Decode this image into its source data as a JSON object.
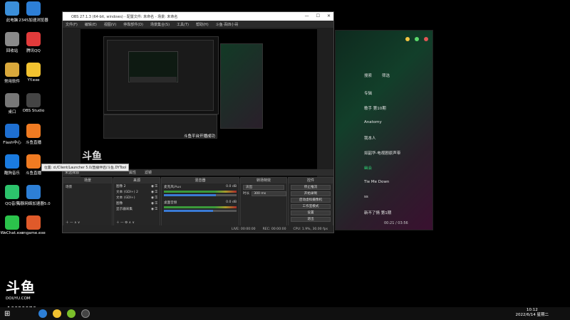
{
  "desktop_icons": [
    {
      "label": "此电脑",
      "color": "#3b8fd9"
    },
    {
      "label": "2345加速浏览器",
      "color": "#2d7fd6"
    },
    {
      "label": "回收站",
      "color": "#8a8a8a"
    },
    {
      "label": "腾讯QQ",
      "color": "#e23b3b"
    },
    {
      "label": "常用软件",
      "color": "#d9a83b"
    },
    {
      "label": "YY.exe",
      "color": "#f2c230"
    },
    {
      "label": "桌口",
      "color": "#777"
    },
    {
      "label": "OBS Studio",
      "color": "#444"
    },
    {
      "label": "Flash中心",
      "color": "#1e6fd1"
    },
    {
      "label": "斗鱼直播",
      "color": "#f07b22"
    },
    {
      "label": "酷狗音乐",
      "color": "#1a7be0"
    },
    {
      "label": "斗鱼直播",
      "color": "#f07b22"
    },
    {
      "label": "QQ音乐",
      "color": "#2cc36b"
    },
    {
      "label": "海豚网络加速器5.0",
      "color": "#2d7fd6"
    },
    {
      "label": "WeChat.exe",
      "color": "#2bc34b"
    },
    {
      "label": "cngame.exe",
      "color": "#e05a2a"
    }
  ],
  "tooltip": "位置: d:/Client/Launcher 5.0/直播伴侣/斗鱼.DYTool",
  "obs": {
    "title": "OBS 27.1.3 (64-bit, windows) - 配置文件: 未命名 - 场景: 未命名",
    "menu": [
      "文件(F)",
      "编辑(E)",
      "视图(V)",
      "停靠部件(D)",
      "场景集合(S)",
      "工具(T)",
      "帮助(H)",
      "斗鱼·百四小哥"
    ],
    "preview_caption": "斗鱼平台开播成功",
    "source_bar": {
      "name": "未选择源",
      "props": "属性",
      "filters": "滤镜"
    },
    "scenes_header": "场景",
    "scenes": [
      "场景"
    ],
    "sources_header": "来源",
    "sources": [
      "图像 2",
      "文本 (GDI+) 2",
      "文本 (GDI+)",
      "图像",
      "显示器采集"
    ],
    "mixer_header": "混音器",
    "mixer": [
      {
        "name": "麦克风/Aux",
        "db": "0.0 dB",
        "level": 0.72
      },
      {
        "name": "桌面音频",
        "db": "0.0 dB",
        "level": 0.68
      }
    ],
    "transitions_header": "转场特效",
    "transition": "淡出",
    "duration_label": "时长",
    "duration": "300 ms",
    "controls_header": "控件",
    "controls": [
      "停止推流",
      "开始录制",
      "启动虚拟摄像机",
      "工作室模式",
      "设置",
      "退出"
    ],
    "status": {
      "live_label": "LIVE: 00:00:00",
      "rec_label": "REC: 00:00:00",
      "cpu": "CPU: 1.9%, 30.00 fps"
    }
  },
  "music": {
    "search": "搜索",
    "filter": "筛选",
    "items": [
      "专辑",
      "歌手 第10期",
      "Anatomy",
      "我本人",
      "如韶华·电视剧原声带",
      "幽会",
      "Tie Me Down",
      "ss",
      "新不了情 第1期"
    ],
    "time": "00:21 / 03:56",
    "accent": "#2ecc71"
  },
  "douyu": {
    "logo": "斗鱼",
    "domain": "DOUYU.COM",
    "room": "10029976"
  },
  "taskbar": {
    "time": "10:12",
    "date": "2022/6/14 星期二"
  }
}
